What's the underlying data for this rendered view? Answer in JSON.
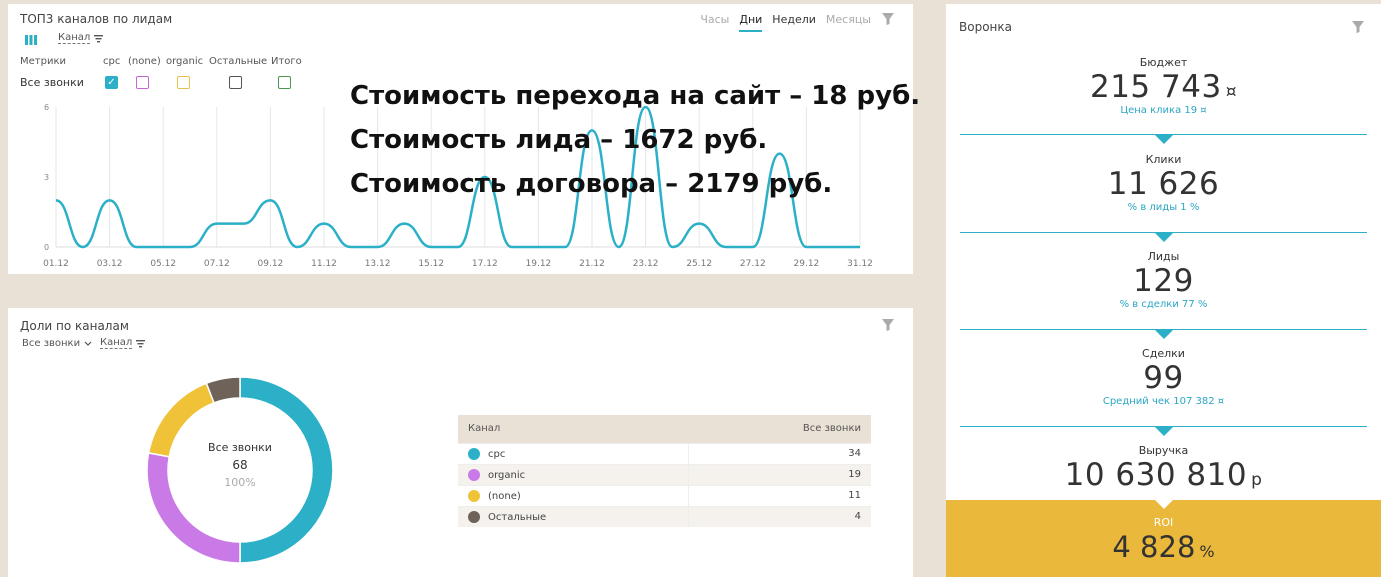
{
  "top_panel": {
    "title": "ТОП3 каналов по лидам",
    "group_by": "Канал",
    "tabs": [
      {
        "label": "Часы",
        "state": "inactive"
      },
      {
        "label": "Дни",
        "state": "active"
      },
      {
        "label": "Недели",
        "state": "normal"
      },
      {
        "label": "Месяцы",
        "state": "inactive"
      }
    ],
    "metrics_label": "Метрики",
    "metric_row": "Все звонки",
    "columns": [
      {
        "label": "cpc",
        "checked": true,
        "color": "#2bb0c8"
      },
      {
        "label": "(none)",
        "checked": false,
        "color": "#c765d7"
      },
      {
        "label": "organic",
        "checked": false,
        "color": "#e9c04a"
      },
      {
        "label": "Остальные",
        "checked": false,
        "color": "#555555"
      },
      {
        "label": "Итого",
        "checked": false,
        "color": "#4a9a4a"
      }
    ]
  },
  "overlay_text": [
    "Стоимость перехода на сайт – 18 руб.",
    "Стоимость лида – 1672 руб.",
    "Стоимость договора – 2179 руб."
  ],
  "chart_data": {
    "type": "line",
    "x": [
      "01.12",
      "02.12",
      "03.12",
      "04.12",
      "05.12",
      "06.12",
      "07.12",
      "08.12",
      "09.12",
      "10.12",
      "11.12",
      "12.12",
      "13.12",
      "14.12",
      "15.12",
      "16.12",
      "17.12",
      "18.12",
      "19.12",
      "20.12",
      "21.12",
      "22.12",
      "23.12",
      "24.12",
      "25.12",
      "26.12",
      "27.12",
      "28.12",
      "29.12",
      "30.12",
      "31.12"
    ],
    "tick_labels": [
      "01.12",
      "03.12",
      "05.12",
      "07.12",
      "09.12",
      "11.12",
      "13.12",
      "15.12",
      "17.12",
      "19.12",
      "21.12",
      "23.12",
      "25.12",
      "27.12",
      "29.12",
      "31.12"
    ],
    "series": [
      {
        "name": "cpc",
        "color": "#2bb0c8",
        "values": [
          2,
          0,
          2,
          0,
          0,
          0,
          1,
          1,
          2,
          0,
          1,
          0,
          0,
          1,
          0,
          0,
          3,
          0,
          0,
          0,
          5,
          0,
          6,
          0,
          1,
          0,
          0,
          4,
          0,
          0,
          0
        ]
      }
    ],
    "yticks": [
      "0",
      "3",
      "6"
    ],
    "ylim": [
      0,
      6
    ],
    "grid": true
  },
  "share_panel": {
    "title": "Доли по каналам",
    "filter": "Все звонки",
    "group_by": "Канал",
    "donut": {
      "label": "Все звонки",
      "total": "68",
      "percent": "100%",
      "slices": [
        {
          "name": "cpc",
          "value": 34,
          "color": "#2bb0c8"
        },
        {
          "name": "organic",
          "value": 19,
          "color": "#c97ae6"
        },
        {
          "name": "(none)",
          "value": 11,
          "color": "#f0c238"
        },
        {
          "name": "Остальные",
          "value": 4,
          "color": "#6e6259"
        }
      ]
    },
    "table": {
      "col_channel": "Канал",
      "col_calls": "Все звонки",
      "rows": [
        {
          "name": "cpc",
          "value": "34",
          "color": "#2bb0c8"
        },
        {
          "name": "organic",
          "value": "19",
          "color": "#c97ae6"
        },
        {
          "name": "(none)",
          "value": "11",
          "color": "#f0c238"
        },
        {
          "name": "Остальные",
          "value": "4",
          "color": "#6e6259"
        }
      ]
    }
  },
  "funnel": {
    "title": "Воронка",
    "stages": [
      {
        "label": "Бюджет",
        "value": "215 743",
        "unit": "¤",
        "rate": "Цена клика 19 ¤"
      },
      {
        "label": "Клики",
        "value": "11 626",
        "unit": "",
        "rate": "% в лиды 1 %"
      },
      {
        "label": "Лиды",
        "value": "129",
        "unit": "",
        "rate": "% в сделки 77 %"
      },
      {
        "label": "Сделки",
        "value": "99",
        "unit": "",
        "rate": "Средний чек 107 382 ¤"
      },
      {
        "label": "Выручка",
        "value": "10 630 810",
        "unit": "р",
        "rate": ""
      }
    ],
    "roi": {
      "label": "ROI",
      "value": "4 828",
      "unit": "%"
    }
  }
}
